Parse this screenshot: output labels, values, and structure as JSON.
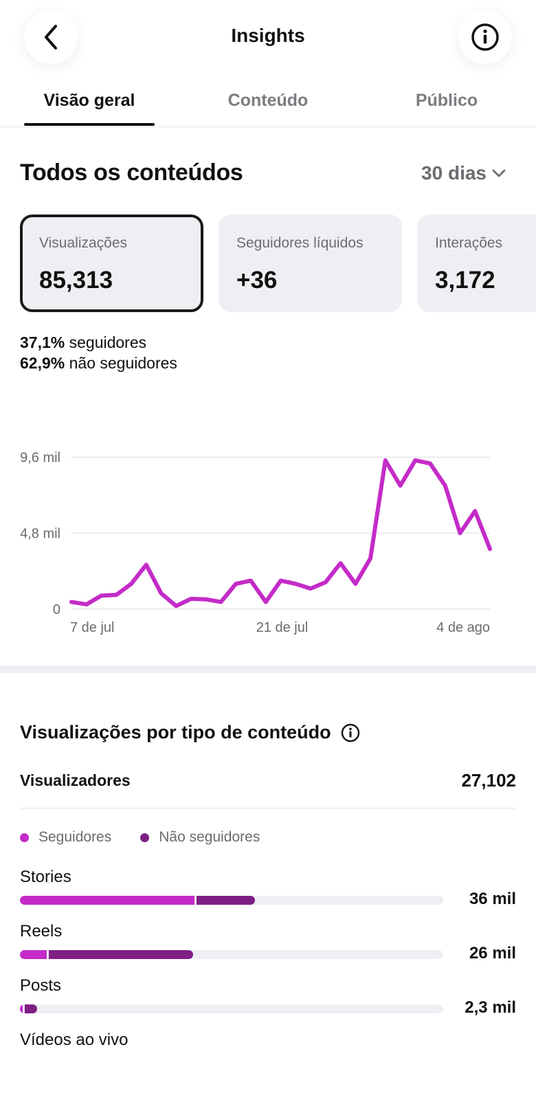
{
  "header": {
    "title": "Insights"
  },
  "tabs": [
    {
      "label": "Visão geral",
      "active": true
    },
    {
      "label": "Conteúdo",
      "active": false
    },
    {
      "label": "Público",
      "active": false
    }
  ],
  "overview": {
    "title": "Todos os conteúdos",
    "range": "30 dias",
    "cards": [
      {
        "label": "Visualizações",
        "value": "85,313",
        "selected": true
      },
      {
        "label": "Seguidores líquidos",
        "value": "+36",
        "selected": false
      },
      {
        "label": "Interações",
        "value": "3,172",
        "selected": false
      }
    ],
    "split": [
      {
        "pct": "37,1%",
        "text": "seguidores"
      },
      {
        "pct": "62,9%",
        "text": "não seguidores"
      }
    ]
  },
  "chart_data": {
    "type": "line",
    "x_tick_labels": [
      "7 de jul",
      "21 de jul",
      "4 de ago"
    ],
    "y_tick_labels": [
      "9,6 mil",
      "4,8 mil",
      "0"
    ],
    "ylim": [
      0,
      9600
    ],
    "grid": true,
    "color": "#c42bc8",
    "series": [
      {
        "values": [
          450,
          300,
          850,
          900,
          1600,
          2800,
          1000,
          200,
          650,
          620,
          450,
          1600,
          1800,
          450,
          1800,
          1600,
          1300,
          1700,
          2900,
          1600,
          3200,
          9400,
          7800,
          9400,
          9200,
          7800,
          4800,
          6200,
          3800
        ]
      }
    ]
  },
  "content_type": {
    "title": "Visualizações por tipo de conteúdo",
    "viewers_label": "Visualizadores",
    "viewers_value": "27,102",
    "legend": [
      {
        "label": "Seguidores",
        "color": "#c42bc8"
      },
      {
        "label": "Não seguidores",
        "color": "#7e1f84"
      }
    ],
    "rows": [
      {
        "label": "Stories",
        "value": "36 mil",
        "followers_fraction": 0.413,
        "non_followers_fraction": 0.143
      },
      {
        "label": "Reels",
        "value": "26 mil",
        "followers_fraction": 0.063,
        "non_followers_fraction": 0.346
      },
      {
        "label": "Posts",
        "value": "2,3 mil",
        "followers_fraction": 0.007,
        "non_followers_fraction": 0.033
      },
      {
        "label": "Vídeos ao vivo",
        "value": "",
        "followers_fraction": 0,
        "non_followers_fraction": 0
      }
    ]
  }
}
